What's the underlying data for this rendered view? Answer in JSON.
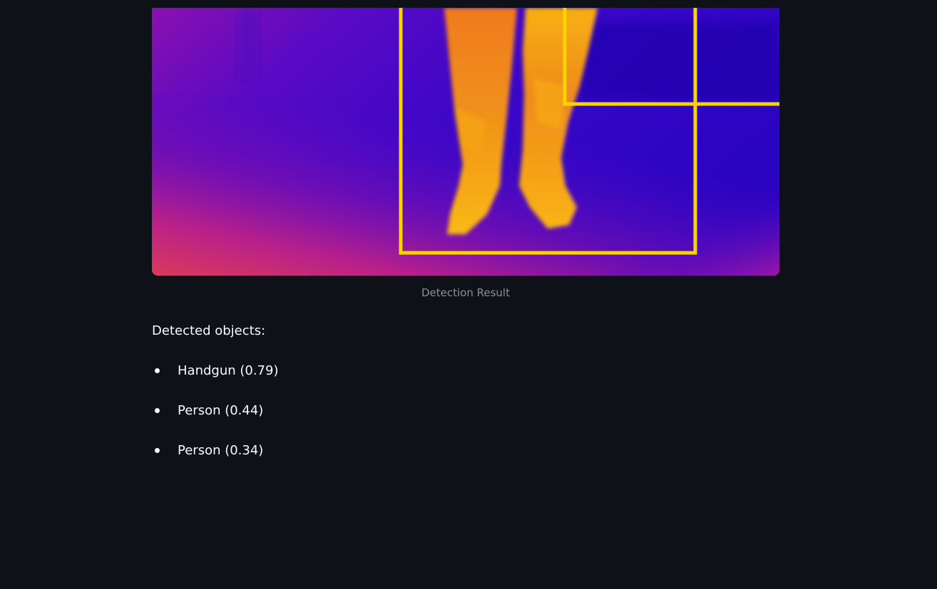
{
  "result_image": {
    "caption": "Detection Result",
    "box_color": "#f5d400",
    "palette": [
      "#3a05c4",
      "#6a0bb3",
      "#9b139f",
      "#d4345f",
      "#f08a18",
      "#fcc20a"
    ]
  },
  "detections": {
    "label": "Detected objects:",
    "items": [
      {
        "text": "Handgun (0.79)"
      },
      {
        "text": "Person (0.44)"
      },
      {
        "text": "Person (0.34)"
      }
    ]
  }
}
